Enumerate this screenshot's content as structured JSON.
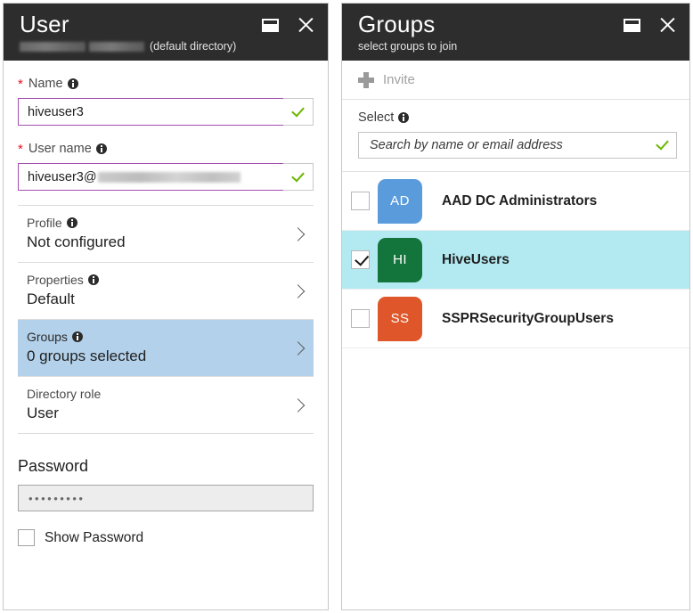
{
  "user_blade": {
    "title": "User",
    "subtitle_suffix": "(default directory)",
    "window_controls": {
      "maximize": "maximize-icon",
      "close": "close-icon"
    },
    "name_field": {
      "label": "Name",
      "required": true,
      "value": "hiveuser3",
      "valid": true
    },
    "username_field": {
      "label": "User name",
      "required": true,
      "value_prefix": "hiveuser3@",
      "value_domain_redacted": true,
      "valid": true
    },
    "nav_rows": [
      {
        "label": "Profile",
        "value": "Not configured",
        "has_info": true,
        "selected": false
      },
      {
        "label": "Properties",
        "value": "Default",
        "has_info": true,
        "selected": false
      },
      {
        "label": "Groups",
        "value": "0 groups selected",
        "has_info": true,
        "selected": true
      },
      {
        "label": "Directory role",
        "value": "User",
        "has_info": false,
        "selected": false
      }
    ],
    "password_section": {
      "title": "Password",
      "value": "•••••••••",
      "show_password_label": "Show Password",
      "show_password_checked": false
    }
  },
  "groups_blade": {
    "title": "Groups",
    "subtitle": "select groups to join",
    "window_controls": {
      "maximize": "maximize-icon",
      "close": "close-icon"
    },
    "command_bar": {
      "invite_label": "Invite",
      "invite_enabled": false,
      "invite_icon": "plus-icon"
    },
    "select_section": {
      "label": "Select",
      "has_info": true,
      "search_placeholder": "Search by name or email address",
      "search_value": "",
      "valid": true
    },
    "groups": [
      {
        "initials": "AD",
        "name": "AAD DC Administrators",
        "color": "#5a9bdc",
        "checked": false,
        "selected": false
      },
      {
        "initials": "HI",
        "name": "HiveUsers",
        "color": "#13753c",
        "checked": true,
        "selected": true
      },
      {
        "initials": "SS",
        "name": "SSPRSecurityGroupUsers",
        "color": "#de5629",
        "checked": false,
        "selected": false
      }
    ]
  },
  "colors": {
    "titlebar_bg": "#2d2d2d",
    "accent_input_border": "#a34fb0",
    "valid_check": "#6bb700",
    "nav_selected_bg": "#b3d1ea",
    "row_selected_bg": "#b3eaf2",
    "required_star": "#e81123"
  }
}
